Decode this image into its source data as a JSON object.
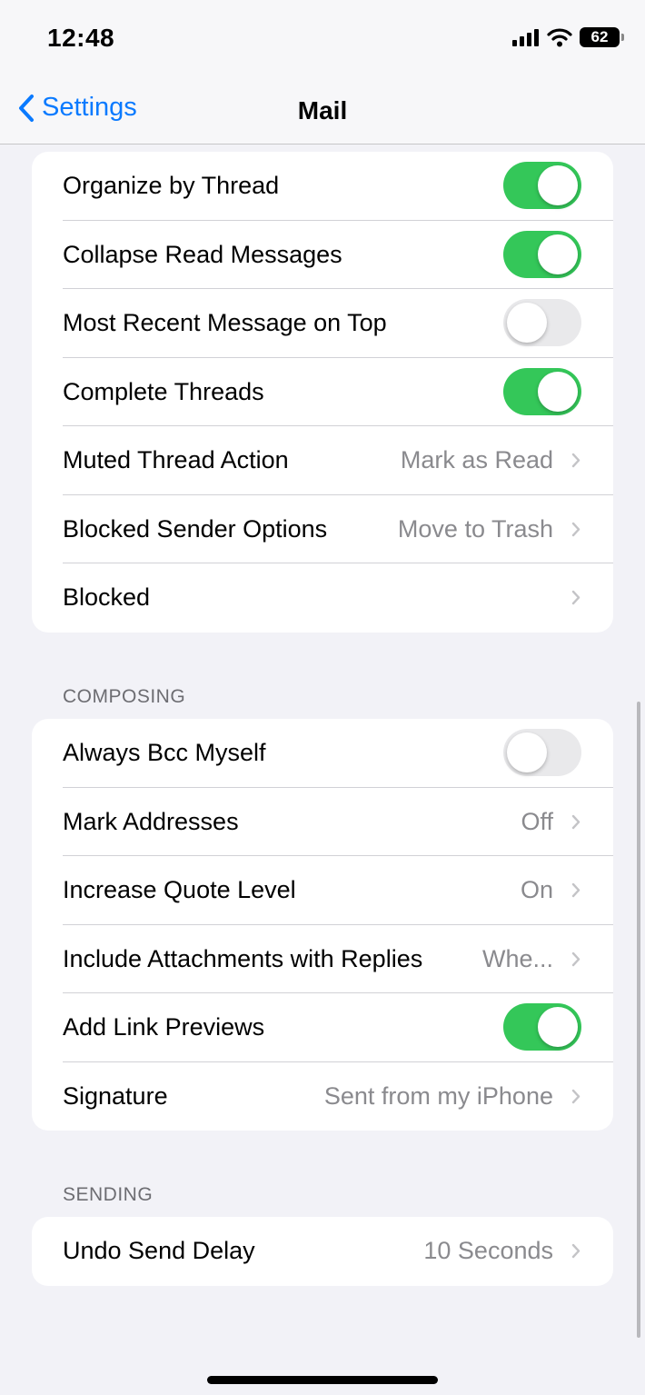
{
  "status": {
    "time": "12:48",
    "battery": "62"
  },
  "nav": {
    "back_label": "Settings",
    "title": "Mail"
  },
  "threading": [
    {
      "label": "Organize by Thread",
      "toggle": true
    },
    {
      "label": "Collapse Read Messages",
      "toggle": true
    },
    {
      "label": "Most Recent Message on Top",
      "toggle": false
    },
    {
      "label": "Complete Threads",
      "toggle": true
    },
    {
      "label": "Muted Thread Action",
      "value": "Mark as Read"
    },
    {
      "label": "Blocked Sender Options",
      "value": "Move to Trash"
    },
    {
      "label": "Blocked",
      "value": ""
    }
  ],
  "composing": {
    "header": "COMPOSING",
    "rows": [
      {
        "label": "Always Bcc Myself",
        "toggle": false
      },
      {
        "label": "Mark Addresses",
        "value": "Off"
      },
      {
        "label": "Increase Quote Level",
        "value": "On"
      },
      {
        "label": "Include Attachments with Replies",
        "value": "Whe..."
      },
      {
        "label": "Add Link Previews",
        "toggle": true
      },
      {
        "label": "Signature",
        "value": "Sent from my iPhone"
      }
    ]
  },
  "sending": {
    "header": "SENDING",
    "rows": [
      {
        "label": "Undo Send Delay",
        "value": "10 Seconds"
      }
    ]
  },
  "colors": {
    "accent": "#0a7aff",
    "toggle_on": "#34c759",
    "toggle_off": "#e9e9eb"
  },
  "icons": [
    "signal-icon",
    "wifi-icon",
    "battery-icon",
    "chevron-left-icon",
    "chevron-right-icon"
  ]
}
